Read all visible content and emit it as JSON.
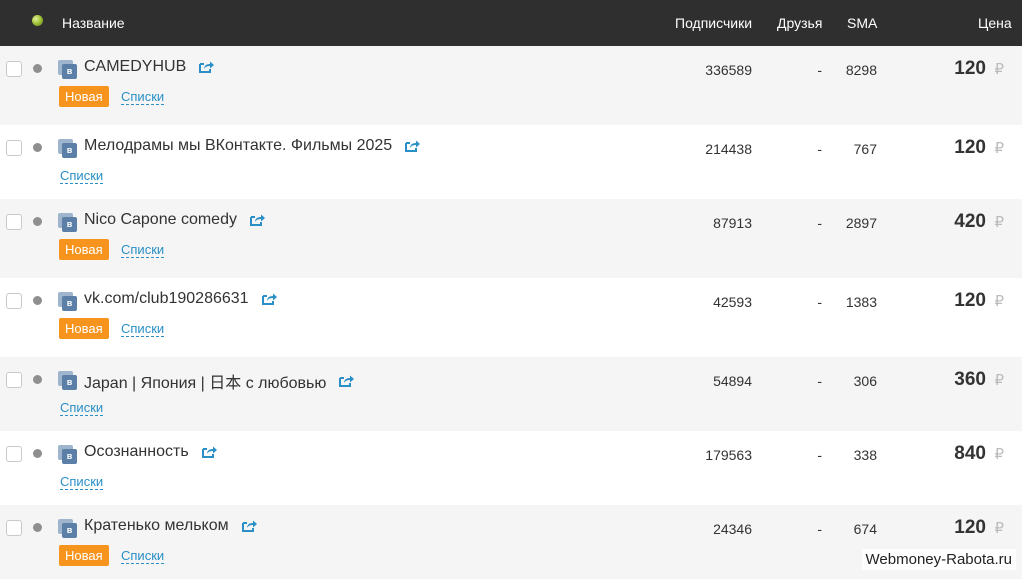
{
  "header": {
    "name": "Название",
    "subscribers": "Подписчики",
    "friends": "Друзья",
    "sma": "SMA",
    "price": "Цена"
  },
  "currency_symbol": "₽",
  "badge_new_label": "Новая",
  "lists_label": "Списки",
  "rows": [
    {
      "title": "CAMEDYHUB",
      "new": true,
      "subscribers": "336589",
      "friends": "-",
      "sma": "8298",
      "price": "120"
    },
    {
      "title": "Мелодрамы мы ВКонтакте. Фильмы 2025",
      "new": false,
      "subscribers": "214438",
      "friends": "-",
      "sma": "767",
      "price": "120"
    },
    {
      "title": "Nico Capone comedy",
      "new": true,
      "subscribers": "87913",
      "friends": "-",
      "sma": "2897",
      "price": "420"
    },
    {
      "title": "vk.com/club190286631",
      "new": true,
      "subscribers": "42593",
      "friends": "-",
      "sma": "1383",
      "price": "120"
    },
    {
      "title": "Japan | Япония | 日本 с любовью",
      "new": false,
      "subscribers": "54894",
      "friends": "-",
      "sma": "306",
      "price": "360"
    },
    {
      "title": "Осознанность",
      "new": false,
      "subscribers": "179563",
      "friends": "-",
      "sma": "338",
      "price": "840"
    },
    {
      "title": "Кратенько мельком",
      "new": true,
      "subscribers": "24346",
      "friends": "-",
      "sma": "674",
      "price": "120"
    }
  ],
  "watermark": "Webmoney-Rabota.ru",
  "colors": {
    "header_bg": "#2f2f2f",
    "badge_new": "#f7941d",
    "link": "#2a8fc7",
    "vk_blue": "#5b7fa6",
    "row_alt": "#f5f5f5"
  },
  "icons": {
    "status": "status-ball-icon",
    "vk": "vk-icon",
    "share": "external-share-icon"
  }
}
